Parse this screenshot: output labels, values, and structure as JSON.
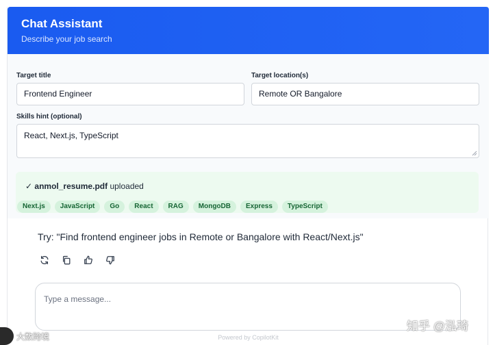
{
  "header": {
    "title": "Chat Assistant",
    "subtitle": "Describe your job search"
  },
  "form": {
    "target_title_label": "Target title",
    "target_title_value": "Frontend Engineer",
    "target_location_label": "Target location(s)",
    "target_location_value": "Remote OR Bangalore",
    "skills_label": "Skills hint (optional)",
    "skills_value": "React, Next.js, TypeScript"
  },
  "upload": {
    "check": "✓",
    "filename": "anmol_resume.pdf",
    "status": "uploaded",
    "skills": [
      "Next.js",
      "JavaScript",
      "Go",
      "React",
      "RAG",
      "MongoDB",
      "Express",
      "TypeScript"
    ]
  },
  "suggestion": {
    "text": "Try: \"Find frontend engineer jobs in Remote or Bangalore with React/Next.js\""
  },
  "message_actions": {
    "icons": [
      "regenerate-icon",
      "copy-icon",
      "thumbs-up-icon",
      "thumbs-down-icon"
    ]
  },
  "composer": {
    "placeholder": "Type a message..."
  },
  "footer": {
    "powered_by": "Powered by CopilotKit"
  },
  "watermarks": {
    "right": "知乎 @泓琦",
    "left": "大数跨境"
  },
  "colors": {
    "header": "#1a5bf0",
    "upload_bg": "#edfaf0",
    "chip_bg": "#d5f2dd",
    "chip_text": "#166534"
  }
}
